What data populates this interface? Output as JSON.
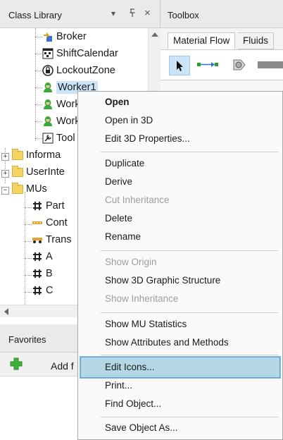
{
  "class_library": {
    "title": "Class Library",
    "header_buttons": [
      "▾",
      "ᵖ",
      "×"
    ],
    "tree_items": [
      {
        "label": "Broker",
        "icon": "broker-icon"
      },
      {
        "label": "ShiftCalendar",
        "icon": "calendar-icon"
      },
      {
        "label": "LockoutZone",
        "icon": "lockout-icon"
      },
      {
        "label": "Worker1",
        "icon": "worker-icon",
        "selected": true
      },
      {
        "label": "Work",
        "icon": "worker-icon"
      },
      {
        "label": "Work",
        "icon": "worker-icon"
      },
      {
        "label": "Tool",
        "icon": "tool-icon"
      },
      {
        "label": "Informa",
        "icon": "folder-icon",
        "expander": "+"
      },
      {
        "label": "UserInte",
        "icon": "folder-icon",
        "expander": "+"
      },
      {
        "label": "MUs",
        "icon": "folder-icon",
        "expander": "−"
      },
      {
        "label": "Part",
        "icon": "part-icon"
      },
      {
        "label": "Cont",
        "icon": "container-icon"
      },
      {
        "label": "Trans",
        "icon": "transporter-icon"
      },
      {
        "label": "A",
        "icon": "part-icon"
      },
      {
        "label": "B",
        "icon": "part-icon"
      },
      {
        "label": "C",
        "icon": "part-icon"
      }
    ]
  },
  "favorites": {
    "title": "Favorites",
    "add_label": "Add f"
  },
  "toolbox": {
    "title": "Toolbox",
    "tabs": [
      "Material Flow",
      "Fluids"
    ],
    "active_tab": "Material Flow"
  },
  "context_menu": {
    "items": [
      {
        "label": "Open",
        "bold": true,
        "disabled": false
      },
      {
        "label": "Open in 3D",
        "disabled": false
      },
      {
        "label": "Edit 3D Properties...",
        "disabled": false
      },
      {
        "separator": true
      },
      {
        "label": "Duplicate",
        "disabled": false
      },
      {
        "label": "Derive",
        "disabled": false
      },
      {
        "label": "Cut Inheritance",
        "disabled": true
      },
      {
        "label": "Delete",
        "disabled": false
      },
      {
        "label": "Rename",
        "disabled": false
      },
      {
        "separator": true
      },
      {
        "label": "Show Origin",
        "disabled": true
      },
      {
        "label": "Show 3D Graphic Structure",
        "disabled": false
      },
      {
        "label": "Show Inheritance",
        "disabled": true
      },
      {
        "separator": true
      },
      {
        "label": "Show MU Statistics",
        "disabled": false
      },
      {
        "label": "Show Attributes and Methods",
        "disabled": false
      },
      {
        "separator": true
      },
      {
        "label": "Edit Icons...",
        "disabled": false,
        "highlighted": true
      },
      {
        "label": "Print...",
        "disabled": false
      },
      {
        "label": "Find Object...",
        "disabled": false
      },
      {
        "separator": true
      },
      {
        "label": "Save Object As...",
        "disabled": false
      }
    ]
  },
  "colors": {
    "selection": "#cce4f7",
    "menu_highlight": "#b4d7e6",
    "menu_highlight_border": "#5aa0d6",
    "worker_green": "#3aa935",
    "add_green": "#3fb23a"
  }
}
